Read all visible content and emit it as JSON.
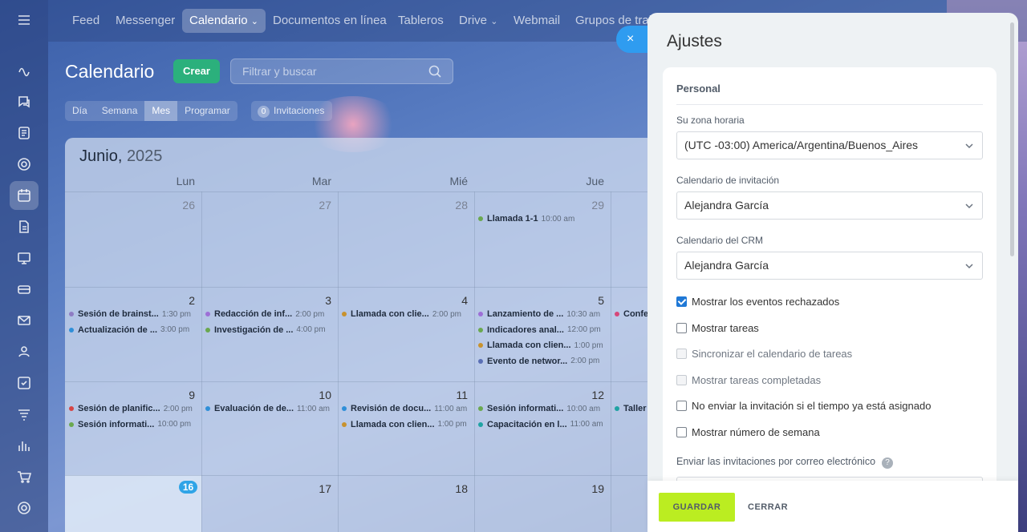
{
  "nav": {
    "items": [
      {
        "label": "Feed",
        "active": false
      },
      {
        "label": "Messenger",
        "active": false
      },
      {
        "label": "Calendario",
        "active": true,
        "chevron": "⌄"
      },
      {
        "label": "Documentos en línea",
        "active": false
      },
      {
        "label": "Tableros",
        "active": false
      },
      {
        "label": "Drive",
        "active": false,
        "chevron": "⌄"
      },
      {
        "label": "Webmail",
        "active": false
      },
      {
        "label": "Grupos de trab",
        "active": false
      }
    ]
  },
  "sidebar": {
    "icons": [
      "menu-icon",
      "activity-icon",
      "chat-icon",
      "feed-icon",
      "projects-icon",
      "calendar-icon",
      "documents-icon",
      "board-icon",
      "drive-icon",
      "mail-icon",
      "contacts-icon",
      "tasks-icon",
      "automation-icon",
      "reports-icon",
      "shop-icon",
      "settings-icon"
    ]
  },
  "header": {
    "title": "Calendario",
    "create_label": "Crear",
    "search_placeholder": "Filtrar y buscar",
    "views": [
      "Día",
      "Semana",
      "Mes",
      "Programar"
    ],
    "active_view": "Mes",
    "invitations_count": "0",
    "invitations_label": "Invitaciones"
  },
  "calendar": {
    "month": "Junio,",
    "year": "2025",
    "day_names": [
      "Lun",
      "Mar",
      "Mié",
      "Jue"
    ],
    "weeks": [
      {
        "dates": [
          "26",
          "27",
          "28",
          "29"
        ],
        "muted": true
      },
      {
        "dates": [
          "2",
          "3",
          "4",
          "5"
        ],
        "muted": false
      },
      {
        "dates": [
          "9",
          "10",
          "11",
          "12"
        ],
        "muted": false
      },
      {
        "dates": [
          "16",
          "17",
          "18",
          "19"
        ],
        "muted": false
      }
    ],
    "events": [
      {
        "week": 0,
        "day": 3,
        "slot": 0,
        "name": "Llamada 1-1",
        "time": "10:00 am",
        "color": "#6aa84f"
      },
      {
        "week": 1,
        "day": 0,
        "slot": 0,
        "name": "Sesión de brainst...",
        "time": "1:30 pm",
        "color": "#8e7cc3"
      },
      {
        "week": 1,
        "day": 0,
        "slot": 1,
        "name": "Actualización de ...",
        "time": "3:00 pm",
        "color": "#2f8fd8"
      },
      {
        "week": 1,
        "day": 1,
        "slot": 0,
        "name": "Redacción de inf...",
        "time": "2:00 pm",
        "color": "#9d6fd6"
      },
      {
        "week": 1,
        "day": 1,
        "slot": 1,
        "name": "Investigación de ...",
        "time": "4:00 pm",
        "color": "#6aa84f"
      },
      {
        "week": 1,
        "day": 2,
        "slot": 0,
        "name": "Llamada con clie...",
        "time": "2:00 pm",
        "color": "#c8922e"
      },
      {
        "week": 1,
        "day": 3,
        "slot": 0,
        "name": "Lanzamiento de ...",
        "time": "10:30 am",
        "color": "#9d6fd6"
      },
      {
        "week": 1,
        "day": 3,
        "slot": 1,
        "name": "Indicadores anal...",
        "time": "12:00 pm",
        "color": "#6aa84f"
      },
      {
        "week": 1,
        "day": 3,
        "slot": 2,
        "name": "Llamada con clien...",
        "time": "1:00 pm",
        "color": "#c8922e"
      },
      {
        "week": 1,
        "day": 3,
        "slot": 3,
        "name": "Evento de networ...",
        "time": "2:00 pm",
        "color": "#5a6fb5"
      },
      {
        "week": 1,
        "day": 4,
        "slot": 0,
        "name": "Confe",
        "time": "",
        "color": "#d6477a"
      },
      {
        "week": 2,
        "day": 0,
        "slot": 0,
        "name": "Sesión de planific...",
        "time": "2:00 pm",
        "color": "#d64545"
      },
      {
        "week": 2,
        "day": 0,
        "slot": 1,
        "name": "Sesión informati...",
        "time": "10:00 pm",
        "color": "#6aa84f"
      },
      {
        "week": 2,
        "day": 1,
        "slot": 0,
        "name": "Evaluación de de...",
        "time": "11:00 am",
        "color": "#2f8fd8"
      },
      {
        "week": 2,
        "day": 2,
        "slot": 0,
        "name": "Revisión de docu...",
        "time": "11:00 am",
        "color": "#2f8fd8"
      },
      {
        "week": 2,
        "day": 2,
        "slot": 1,
        "name": "Llamada con clien...",
        "time": "1:00 pm",
        "color": "#c8922e"
      },
      {
        "week": 2,
        "day": 3,
        "slot": 0,
        "name": "Sesión informati...",
        "time": "10:00 am",
        "color": "#6aa84f"
      },
      {
        "week": 2,
        "day": 3,
        "slot": 1,
        "name": "Capacitación en l...",
        "time": "11:00 am",
        "color": "#1fa3a3"
      },
      {
        "week": 2,
        "day": 4,
        "slot": 0,
        "name": "Taller",
        "time": "",
        "color": "#1fa3a3"
      }
    ],
    "today_date": "16"
  },
  "settings": {
    "title": "Ajustes",
    "close_icon": "×",
    "section_title": "Personal",
    "timezone_label": "Su zona horaria",
    "timezone_value": "(UTC -03:00) America/Argentina/Buenos_Aires",
    "invite_calendar_label": "Calendario de invitación",
    "invite_calendar_value": "Alejandra García",
    "crm_calendar_label": "Calendario del CRM",
    "crm_calendar_value": "Alejandra García",
    "checkboxes": [
      {
        "label": "Mostrar los eventos rechazados",
        "checked": true,
        "disabled": false
      },
      {
        "label": "Mostrar tareas",
        "checked": false,
        "disabled": false
      },
      {
        "label": "Sincronizar el calendario de tareas",
        "checked": false,
        "disabled": true
      },
      {
        "label": "Mostrar tareas completadas",
        "checked": false,
        "disabled": true
      },
      {
        "label": "No enviar la invitación si el tiempo ya está asignado",
        "checked": false,
        "disabled": false
      },
      {
        "label": "Mostrar número de semana",
        "checked": false,
        "disabled": false
      }
    ],
    "email_invites_label": "Enviar las invitaciones por correo electrónico",
    "help_icon": "?",
    "save_label": "GUARDAR",
    "close_label": "CERRAR"
  },
  "colors": {
    "accent_green": "#2bb07c",
    "save_green": "#bbed21",
    "close_blue": "#2f9cf0",
    "today_blue": "#2fa4e7"
  }
}
